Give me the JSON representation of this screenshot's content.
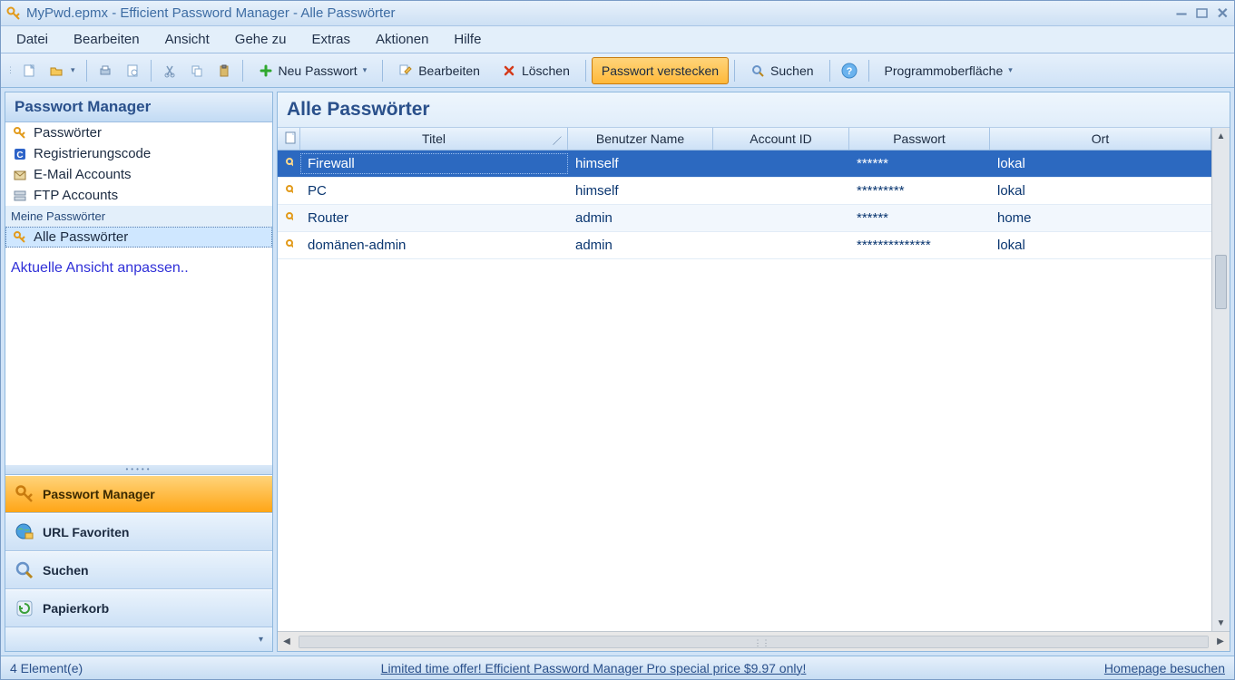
{
  "title_bar": {
    "text": "MyPwd.epmx - Efficient Password Manager - Alle Passwörter"
  },
  "menu": [
    "Datei",
    "Bearbeiten",
    "Ansicht",
    "Gehe zu",
    "Extras",
    "Aktionen",
    "Hilfe"
  ],
  "toolbar": {
    "new": "Neu Passwort",
    "edit": "Bearbeiten",
    "delete": "Löschen",
    "hide": "Passwort verstecken",
    "search": "Suchen",
    "skin": "Programmoberfläche"
  },
  "sidebar_header": "Passwort Manager",
  "tree_items": [
    {
      "label": "Passwörter",
      "icon": "key"
    },
    {
      "label": "Registrierungscode",
      "icon": "reg"
    },
    {
      "label": "E-Mail Accounts",
      "icon": "mail"
    },
    {
      "label": "FTP Accounts",
      "icon": "ftp"
    }
  ],
  "tree_section_header": "Meine Passwörter",
  "tree_selected": "Alle Passwörter",
  "tree_custom_link": "Aktuelle Ansicht anpassen..",
  "nav": [
    {
      "label": "Passwort Manager",
      "icon": "key",
      "active": true
    },
    {
      "label": "URL Favoriten",
      "icon": "globe",
      "active": false
    },
    {
      "label": "Suchen",
      "icon": "search",
      "active": false
    },
    {
      "label": "Papierkorb",
      "icon": "recycle",
      "active": false
    }
  ],
  "main_title": "Alle Passwörter",
  "columns": {
    "title": "Titel",
    "user": "Benutzer Name",
    "account": "Account ID",
    "password": "Passwort",
    "location": "Ort"
  },
  "rows": [
    {
      "title": "Firewall",
      "user": "himself",
      "account": "",
      "password": "******",
      "location": "lokal",
      "selected": true
    },
    {
      "title": "PC",
      "user": "himself",
      "account": "",
      "password": "*********",
      "location": "lokal",
      "selected": false
    },
    {
      "title": "Router",
      "user": "admin",
      "account": "",
      "password": "******",
      "location": "home",
      "selected": false
    },
    {
      "title": "domänen-admin",
      "user": "admin",
      "account": "",
      "password": "**************",
      "location": "lokal",
      "selected": false
    }
  ],
  "status": {
    "count": "4 Element(e)",
    "promo": "Limited time offer! Efficient Password Manager Pro special price $9.97 only!",
    "homepage": "Homepage besuchen"
  }
}
